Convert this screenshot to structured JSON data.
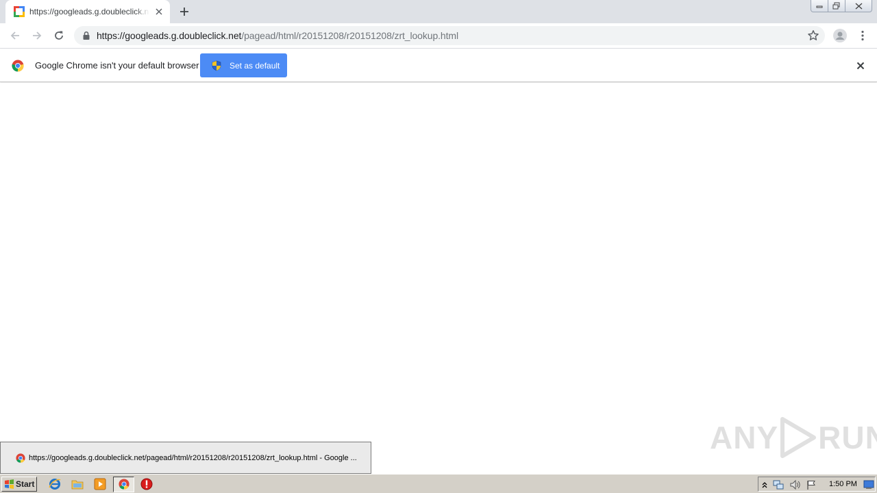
{
  "browser": {
    "tab": {
      "title": "https://googleads.g.doubleclick.net/pagead/html/r20151208/r20151208/zrt_lookup.html"
    },
    "address_bar": {
      "url_host": "https://googleads.g.doubleclick.net",
      "url_path": "/pagead/html/r20151208/r20151208/zrt_lookup.html"
    },
    "infobar": {
      "message": "Google Chrome isn't your default browser",
      "button_label": "Set as default"
    }
  },
  "watermark": {
    "left": "ANY",
    "right": "RUN"
  },
  "taskbar": {
    "start_label": "Start",
    "preview_text": "https://googleads.g.doubleclick.net/pagead/html/r20151208/r20151208/zrt_lookup.html - Google ...",
    "clock": "1:50 PM"
  },
  "colors": {
    "accent_button": "#4c8bf5",
    "tabstrip": "#dee1e6",
    "omnibox": "#f1f3f4",
    "taskbar": "#d4d0c8"
  }
}
